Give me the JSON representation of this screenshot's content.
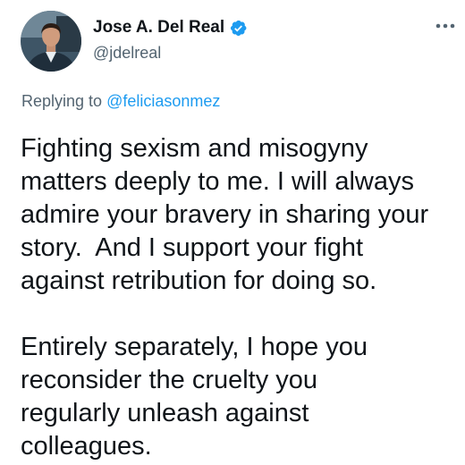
{
  "tweet": {
    "author": {
      "display_name": "Jose A. Del Real",
      "handle": "@jdelreal",
      "verified": true,
      "avatar_icon": "profile-photo"
    },
    "more_icon": "more-options-icon",
    "reply": {
      "prefix": "Replying to ",
      "to": "@feliciasonmez"
    },
    "paragraphs": [
      [
        "Fighting sexism and misogyny",
        "matters deeply to me. I will always",
        "admire your bravery in sharing your",
        "story.  And I support your fight",
        "against retribution for doing so."
      ],
      [
        "Entirely separately, I hope you",
        "reconsider the cruelty you",
        "regularly unleash against",
        "colleagues."
      ]
    ],
    "colors": {
      "text": "#0f1419",
      "secondary": "#536471",
      "accent": "#1d9bf0"
    }
  }
}
